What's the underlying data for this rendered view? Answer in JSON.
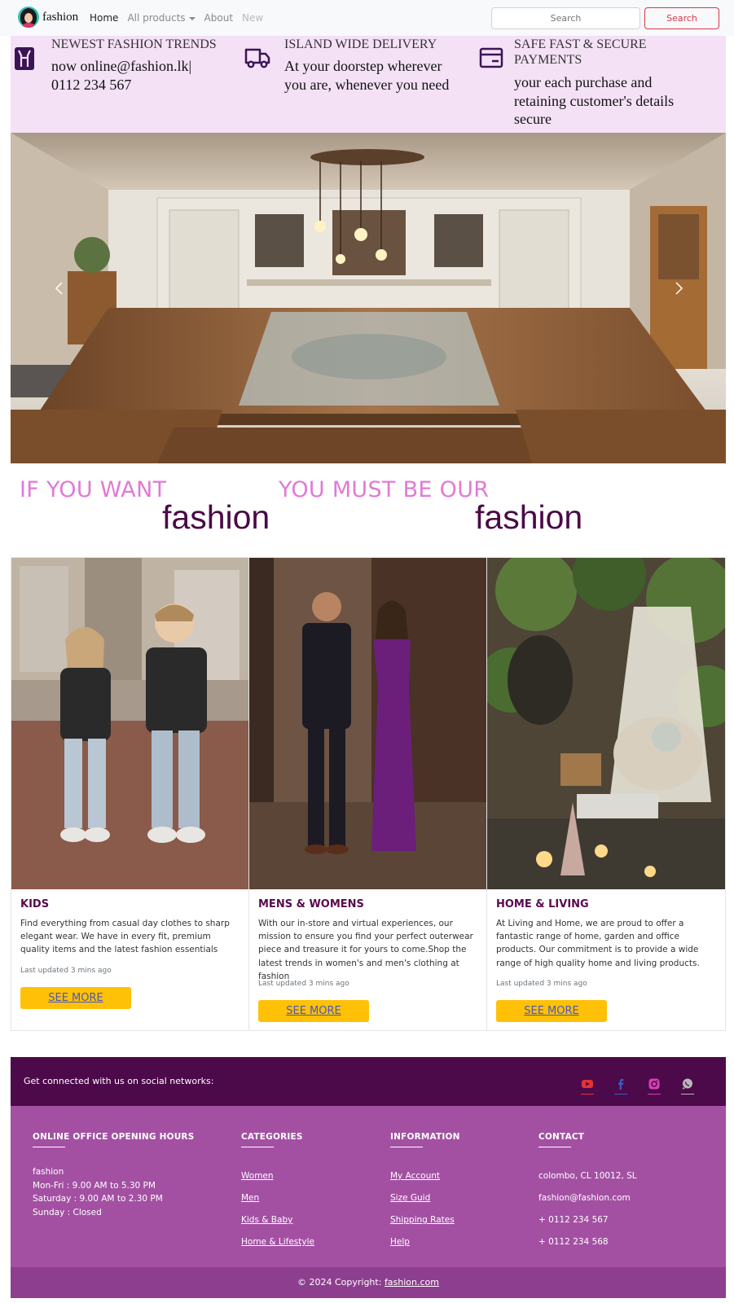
{
  "navbar": {
    "brand": "fashion",
    "links": {
      "home": "Home",
      "all_products": "All products",
      "about": "About",
      "new": "New"
    },
    "search_placeholder": "Search",
    "search_button": "Search"
  },
  "features": [
    {
      "title": "NEWEST FASHION TRENDS",
      "text": "now online@fashion.lk|\n0112 234 567",
      "icon": "clothing-tag-icon"
    },
    {
      "title": "ISLAND WIDE DELIVERY",
      "text": "At your doorstep wherever\nyou are, whenever you need",
      "icon": "truck-icon"
    },
    {
      "title": "SAFE FAST & SECURE\nPAYMENTS",
      "text": "your each purchase and\nretaining customer's details\nsecure",
      "icon": "credit-card-icon"
    }
  ],
  "carousel": {
    "prev_icon": "chevron-left-icon",
    "next_icon": "chevron-right-icon"
  },
  "tagline": {
    "part1": "IF YOU WANT",
    "word1": "fashion",
    "part2": "YOU MUST BE OUR",
    "word2": "fashion"
  },
  "cards": [
    {
      "title": "KIDS",
      "text": "Find everything from casual day clothes to sharp elegant wear. We have in every fit, premium quality items and the latest fashion essentials",
      "updated": "Last updated 3 mins ago",
      "button": "SEE MORE"
    },
    {
      "title": "MENS & WOMENS",
      "text": "With our in-store and virtual experiences, our mission to ensure you find your perfect outerwear piece and treasure it for yours to come.Shop the latest trends in women's and men's clothing at fashion",
      "updated": "Last updated 3 mins ago",
      "button": "SEE MORE"
    },
    {
      "title": "HOME & LIVING",
      "text": "At Living and Home, we are proud to offer a fantastic range of home, garden and office products. Our commitment is to provide a wide range of high quality home and living products.",
      "updated": "Last updated 3 mins ago",
      "button": "SEE MORE"
    }
  ],
  "social": {
    "text": "Get connected with us on social networks:",
    "icons": [
      "youtube-icon",
      "facebook-icon",
      "instagram-icon",
      "whatsapp-icon"
    ],
    "colors": {
      "youtube": "#e3342f",
      "facebook": "#3b5cc4",
      "instagram": "#d63fb2",
      "whatsapp": "#b8b8b8"
    }
  },
  "footer": {
    "hours": {
      "heading": "ONLINE OFFICE OPENING HOURS",
      "lines": [
        "fashion",
        "Mon-Fri : 9.00 AM to 5.30 PM",
        "Saturday : 9.00 AM to 2.30 PM",
        "Sunday : Closed"
      ]
    },
    "categories": {
      "heading": "CATEGORIES",
      "items": [
        "Women",
        "Men",
        "Kids & Baby",
        "Home & Lifestyle"
      ]
    },
    "information": {
      "heading": "INFORMATION",
      "items": [
        "My Account",
        "Size Guid",
        "Shipping Rates",
        "Help"
      ]
    },
    "contact": {
      "heading": "CONTACT",
      "items": [
        "colombo, CL 10012, SL",
        "fashion@fashion.com",
        "+ 0112 234 567",
        "+ 0112 234 568"
      ]
    }
  },
  "copyright": {
    "text": "© 2024 Copyright: ",
    "link": "fashion.com"
  },
  "colors": {
    "accent_pink": "#e07ad6",
    "brand_purple": "#4a0a46",
    "footer_purple": "#a350a3",
    "button_yellow": "#ffc107",
    "danger": "#dc3545"
  }
}
